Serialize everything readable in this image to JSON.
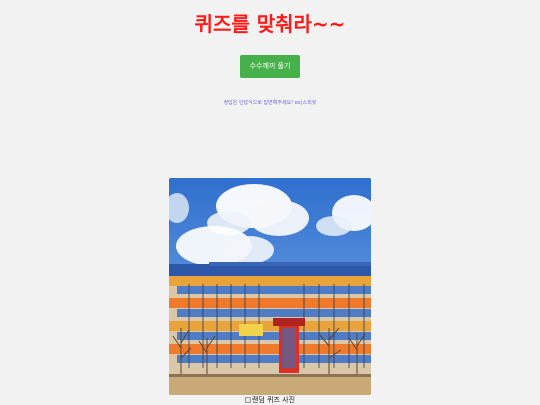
{
  "title": "퀴즈를 맞춰라~~",
  "quiz_button_label": "수수께끼 풀기",
  "hint_text": "정답은 단답식으로 답변해주세요! ex)스피릿",
  "image_alt": "랜덤 퀴즈 사진",
  "colors": {
    "title": "#ff1a1a",
    "button": "#46b04a",
    "hint": "#6b6bdc",
    "background": "#f2f2f2"
  }
}
